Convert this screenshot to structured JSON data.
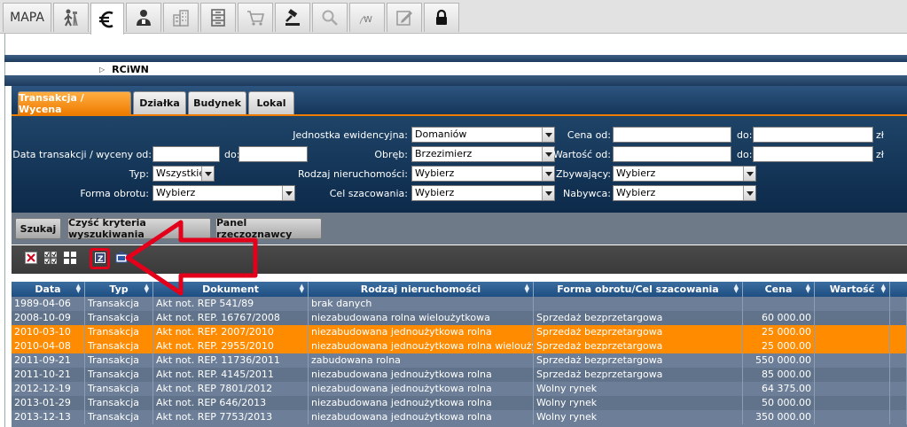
{
  "toolbar": {
    "mapa_label": "MAPA",
    "tabs": [
      {
        "icon": "surveyor-icon"
      },
      {
        "icon": "euro-icon",
        "active": true
      },
      {
        "icon": "user-icon"
      },
      {
        "icon": "building-icon"
      },
      {
        "icon": "register-icon"
      },
      {
        "icon": "cart-icon"
      },
      {
        "icon": "gavel-icon"
      },
      {
        "icon": "magnifier-icon"
      },
      {
        "icon": "w-icon",
        "label": "W"
      },
      {
        "icon": "edit-icon"
      },
      {
        "icon": "lock-icon"
      }
    ]
  },
  "breadcrumb": {
    "title": "RCiWN"
  },
  "filter_tabs": [
    "Transakcja / Wycena",
    "Działka",
    "Budynek",
    "Lokal"
  ],
  "form": {
    "jednostka_label": "Jednostka ewidencyjna:",
    "jednostka_value": "Domaniów",
    "obreb_label": "Obręb:",
    "obreb_value": "Brzezimierz",
    "rodzaj_label": "Rodzaj nieruchomości:",
    "rodzaj_value": "Wybierz",
    "cel_label": "Cel szacowania:",
    "cel_value": "Wybierz",
    "data_label": "Data transakcji / wyceny od:",
    "data_do_label": "do:",
    "typ_label": "Typ:",
    "typ_value": "Wszystkie",
    "forma_label": "Forma obrotu:",
    "forma_value": "Wybierz",
    "cena_label": "Cena od:",
    "cena_do_label": "do:",
    "cena_unit": "zł",
    "wartosc_label": "Wartość od:",
    "wartosc_do_label": "do:",
    "wartosc_unit": "zł",
    "zbywajacy_label": "Zbywający:",
    "zbywajacy_value": "Wybierz",
    "nabywca_label": "Nabywca:",
    "nabywca_value": "Wybierz"
  },
  "buttons": {
    "search": "Szukaj",
    "clear": "Czyść kryteria wyszukiwania",
    "panel": "Panel rzeczoznawcy"
  },
  "icon_toolbar": [
    "delete-icon",
    "check-all-icon",
    "grid-icon",
    "z-report-icon",
    "export-icon"
  ],
  "colors": {
    "accent": "#ee7c00",
    "highlight_row": "#ff8c00",
    "header": "#1f4f82",
    "annotation": "#e2001a"
  },
  "table": {
    "columns": [
      "Data",
      "Typ",
      "Dokument",
      "Rodzaj nieruchomości",
      "Forma obrotu/Cel szacowania",
      "Cena",
      "Wartość"
    ],
    "rows": [
      {
        "data": "1989-04-06",
        "typ": "Transakcja",
        "dokument": "Akt not. REP 541/89",
        "rodzaj": "brak danych",
        "forma": "",
        "cena": "",
        "wartosc": "",
        "highlight": false
      },
      {
        "data": "2008-10-09",
        "typ": "Transakcja",
        "dokument": "Akt not. REP. 16767/2008",
        "rodzaj": "niezabudowana rolna wieloużytkowa",
        "forma": "Sprzedaż bezprzetargowa",
        "cena": "60 000.00",
        "wartosc": "",
        "highlight": false
      },
      {
        "data": "2010-03-10",
        "typ": "Transakcja",
        "dokument": "Akt not. REP. 2007/2010",
        "rodzaj": "niezabudowana jednoużytkowa rolna",
        "forma": "Sprzedaż bezprzetargowa",
        "cena": "25 000.00",
        "wartosc": "",
        "highlight": true
      },
      {
        "data": "2010-04-08",
        "typ": "Transakcja",
        "dokument": "Akt not. REP. 2955/2010",
        "rodzaj": "niezabudowana jednoużytkowa rolna wieloużytkowa",
        "forma": "Sprzedaż bezprzetargowa",
        "cena": "25 000.00",
        "wartosc": "",
        "highlight": true
      },
      {
        "data": "2011-09-21",
        "typ": "Transakcja",
        "dokument": "Akt not. REP. 11736/2011",
        "rodzaj": "zabudowana rolna",
        "forma": "Sprzedaż bezprzetargowa",
        "cena": "550 000.00",
        "wartosc": "",
        "highlight": false
      },
      {
        "data": "2011-10-21",
        "typ": "Transakcja",
        "dokument": "Akt not. REP. 4145/2011",
        "rodzaj": "niezabudowana jednoużytkowa rolna",
        "forma": "Sprzedaż bezprzetargowa",
        "cena": "85 000.00",
        "wartosc": "",
        "highlight": false
      },
      {
        "data": "2012-12-19",
        "typ": "Transakcja",
        "dokument": "Akt not. REP 7801/2012",
        "rodzaj": "niezabudowana jednoużytkowa rolna",
        "forma": "Wolny rynek",
        "cena": "64 375.00",
        "wartosc": "",
        "highlight": false
      },
      {
        "data": "2013-01-29",
        "typ": "Transakcja",
        "dokument": "Akt not. REP 646/2013",
        "rodzaj": "niezabudowana jednoużytkowa rolna",
        "forma": "Wolny rynek",
        "cena": "50 000.00",
        "wartosc": "",
        "highlight": false
      },
      {
        "data": "2013-12-13",
        "typ": "Transakcja",
        "dokument": "Akt not. REP 7753/2013",
        "rodzaj": "niezabudowana jednoużytkowa rolna",
        "forma": "Wolny rynek",
        "cena": "350 000.00",
        "wartosc": "",
        "highlight": false
      }
    ]
  }
}
